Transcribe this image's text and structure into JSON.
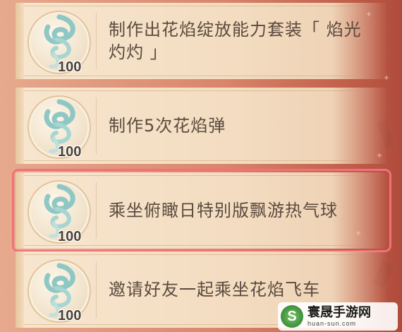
{
  "tasks": [
    {
      "reward_qty": "100",
      "text": "制作出花焰绽放能力套装「 焰光灼灼 」",
      "highlighted": false
    },
    {
      "reward_qty": "100",
      "text": "制作5次花焰弹",
      "highlighted": false
    },
    {
      "reward_qty": "100",
      "text": "乘坐俯瞰日特别版飘游热气球",
      "highlighted": true
    },
    {
      "reward_qty": "100",
      "text": "邀请好友一起乘坐花焰飞车",
      "highlighted": false
    }
  ],
  "reward_icon": "swirl-wind-icon",
  "watermark": {
    "logo_letter": "S",
    "name": "寰晟手游网",
    "url": "huan-sun.com"
  },
  "colors": {
    "highlight_border": "#f2707a",
    "card_bg": "#f3dcc0",
    "text": "#5b4a3f"
  }
}
